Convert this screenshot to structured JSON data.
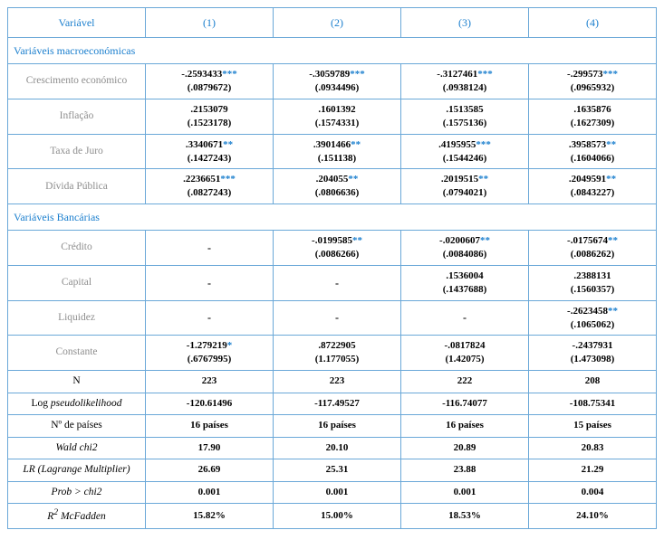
{
  "header": {
    "variable": "Variável",
    "cols": [
      "(1)",
      "(2)",
      "(3)",
      "(4)"
    ]
  },
  "sections": {
    "macro": "Variáveis macroeconómicas",
    "bank": "Variáveis Bancárias"
  },
  "rows": {
    "growth": {
      "label": "Crescimento económico",
      "coef": [
        "-.2593433",
        "-.3059789",
        "-.3127461",
        "-.299573"
      ],
      "star": [
        "***",
        "***",
        "***",
        "***"
      ],
      "se": [
        "(.0879672)",
        "(.0934496)",
        "(.0938124)",
        "(.0965932)"
      ]
    },
    "inflation": {
      "label": "Inflação",
      "coef": [
        ".2153079",
        ".1601392",
        ".1513585",
        ".1635876"
      ],
      "star": [
        "",
        "",
        "",
        ""
      ],
      "se": [
        "(.1523178)",
        "(.1574331)",
        "(.1575136)",
        "(.1627309)"
      ]
    },
    "interest": {
      "label": "Taxa de Juro",
      "coef": [
        ".3340671",
        ".3901466",
        ".4195955",
        ".3958573"
      ],
      "star": [
        "**",
        "**",
        "***",
        "**"
      ],
      "se": [
        "(.1427243)",
        "(.151138)",
        "(.1544246)",
        "(.1604066)"
      ]
    },
    "debt": {
      "label": "Dívida Pública",
      "coef": [
        ".2236651",
        ".204055",
        ".2019515",
        ".2049591"
      ],
      "star": [
        "***",
        "**",
        "**",
        "**"
      ],
      "se": [
        "(.0827243)",
        "(.0806636)",
        "(.0794021)",
        "(.0843227)"
      ]
    },
    "credit": {
      "label": "Crédito",
      "cells": [
        {
          "dash": true
        },
        {
          "coef": "-.0199585",
          "star": "**",
          "se": "(.0086266)"
        },
        {
          "coef": "-.0200607",
          "star": "**",
          "se": "(.0084086)"
        },
        {
          "coef": "-.0175674",
          "star": "**",
          "se": "(.0086262)"
        }
      ]
    },
    "capital": {
      "label": "Capital",
      "cells": [
        {
          "dash": true
        },
        {
          "dash": true
        },
        {
          "coef": ".1536004",
          "star": "",
          "se": "(.1437688)"
        },
        {
          "coef": ".2388131",
          "star": "",
          "se": "(.1560357)"
        }
      ]
    },
    "liquidity": {
      "label": "Liquidez",
      "cells": [
        {
          "dash": true
        },
        {
          "dash": true
        },
        {
          "dash": true
        },
        {
          "coef": "-.2623458",
          "star": "**",
          "se": "(.1065062)"
        }
      ]
    },
    "constant": {
      "label": "Constante",
      "coef": [
        "-1.279219",
        ".8722905",
        "-.0817824",
        "-.2437931"
      ],
      "star": [
        "*",
        "",
        "",
        ""
      ],
      "se": [
        "(.6767995)",
        "(1.177055)",
        "(1.42075)",
        "(1.473098)"
      ]
    }
  },
  "stats": {
    "N": {
      "label": "N",
      "vals": [
        "223",
        "223",
        "222",
        "208"
      ]
    },
    "logpl": {
      "label_pre": "Log ",
      "label_ital": "pseudolikelihood",
      "vals": [
        "-120.61496",
        "-117.49527",
        "-116.74077",
        "-108.75341"
      ]
    },
    "countries": {
      "label": "Nº de países",
      "vals": [
        "16 países",
        "16 países",
        "16 países",
        "15 países"
      ]
    },
    "wald": {
      "label_ital": "Wald chi2",
      "vals": [
        "17.90",
        "20.10",
        "20.89",
        "20.83"
      ]
    },
    "lr": {
      "label_ital": "LR (Lagrange Multiplier)",
      "vals": [
        "26.69",
        "25.31",
        "23.88",
        "21.29"
      ]
    },
    "prob": {
      "label_ital": "Prob > chi2",
      "vals": [
        "0.001",
        "0.001",
        "0.001",
        "0.004"
      ]
    },
    "r2": {
      "label_pre": "R",
      "label_sup": "2",
      "label_ital": " McFadden",
      "vals": [
        "15.82%",
        "15.00%",
        "18.53%",
        "24.10%"
      ]
    }
  },
  "dash": "-"
}
